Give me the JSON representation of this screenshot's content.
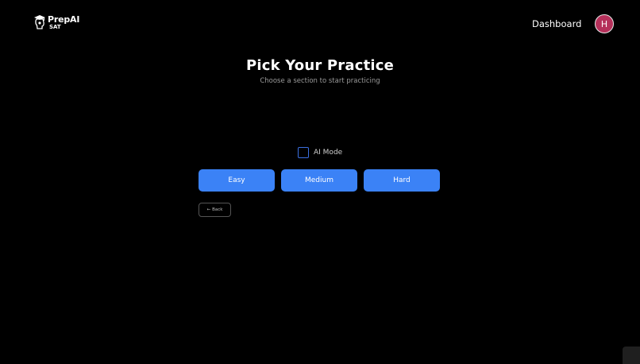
{
  "header": {
    "logo_name": "PrepAI",
    "logo_sub": "SAT",
    "logo_icon": "graduation-cap-head-icon",
    "nav_dashboard": "Dashboard",
    "avatar_initial": "H",
    "avatar_color": "#b5305a"
  },
  "main": {
    "title": "Pick Your Practice",
    "subtitle": "Choose a section to start practicing",
    "ai_mode_label": "AI Mode",
    "ai_mode_checked": false,
    "difficulty_buttons": [
      "Easy",
      "Medium",
      "Hard"
    ],
    "back_arrow": "←",
    "back_label": "Back"
  },
  "colors": {
    "background": "#000000",
    "accent": "#3b82f6",
    "checkbox_border": "#3b6fe0"
  }
}
